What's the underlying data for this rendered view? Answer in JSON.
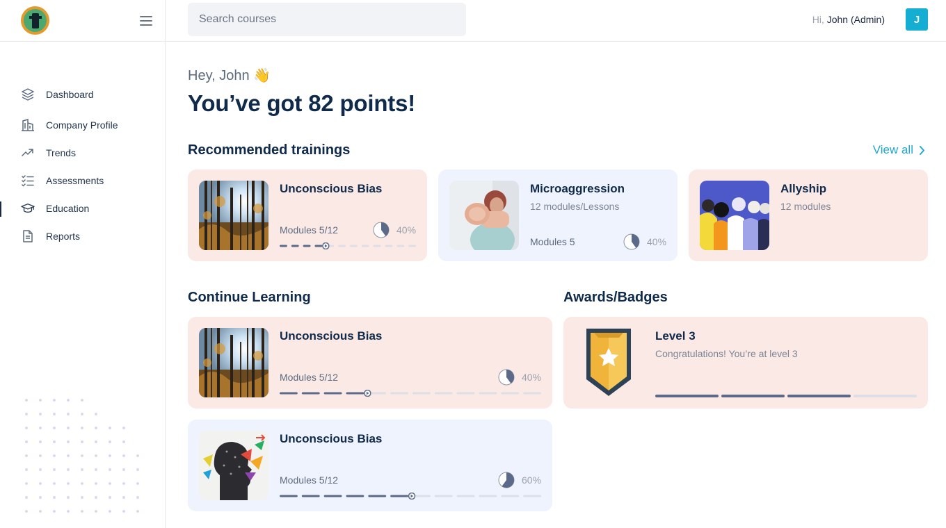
{
  "header": {
    "search_placeholder": "Search courses",
    "greeting_prefix": "Hi,",
    "user_name": "John (Admin)",
    "avatar_letter": "J"
  },
  "sidebar": {
    "items": [
      {
        "label": "Dashboard",
        "icon": "layers-icon"
      },
      {
        "label": "Company Profile",
        "icon": "building-icon"
      },
      {
        "label": "Trends",
        "icon": "trend-up-icon"
      },
      {
        "label": "Assessments",
        "icon": "checklist-icon"
      },
      {
        "label": "Education",
        "icon": "graduation-cap-icon",
        "active": true
      },
      {
        "label": "Reports",
        "icon": "document-icon"
      }
    ]
  },
  "main": {
    "greeting": "Hey, John 👋",
    "points_headline": "You’ve got 82 points!",
    "recommended": {
      "title": "Recommended trainings",
      "view_all": "View all",
      "cards": [
        {
          "title": "Unconscious Bias",
          "modules": "Modules 5/12",
          "percent": "40%",
          "progress": 0.4
        },
        {
          "title": "Microaggression",
          "subtitle": "12 modules/Lessons",
          "modules": "Modules 5",
          "percent": "40%",
          "progress": 0.4
        },
        {
          "title": "Allyship",
          "subtitle": "12 modules"
        }
      ]
    },
    "continue": {
      "title": "Continue Learning",
      "cards": [
        {
          "title": "Unconscious Bias",
          "modules": "Modules 5/12",
          "percent": "40%",
          "progress": 0.4
        },
        {
          "title": "Unconscious Bias",
          "modules": "Modules 5/12",
          "percent": "60%",
          "progress": 0.6
        }
      ]
    },
    "awards": {
      "title": "Awards/Badges",
      "level_title": "Level 3",
      "level_message": "Congratulations! You’re at level 3",
      "progress": 0.75
    }
  },
  "colors": {
    "accent": "#13aed2",
    "card_pink": "#fbe9e5",
    "card_blue": "#eef3fd",
    "progress_filled": "#5c6a8a",
    "progress_empty": "#dcdfe6"
  }
}
